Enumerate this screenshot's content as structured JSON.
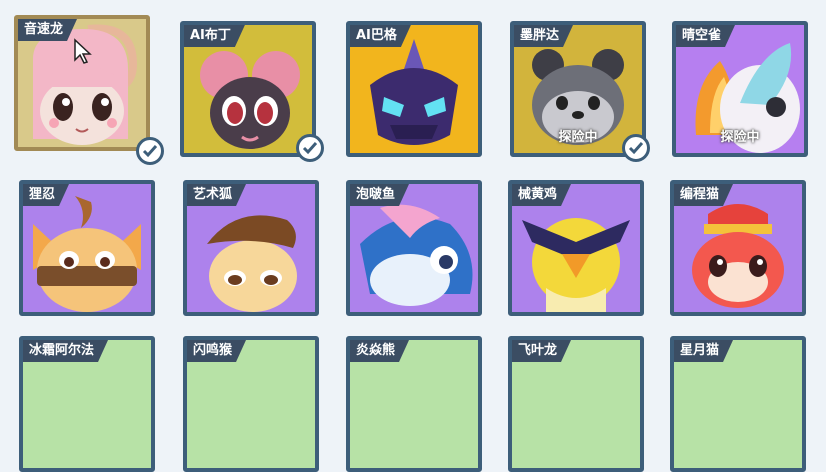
{
  "cards": [
    {
      "name": "音速龙",
      "status": "",
      "checked": true,
      "selected": true
    },
    {
      "name": "AI布丁",
      "status": "",
      "checked": true,
      "selected": false
    },
    {
      "name": "AI巴格",
      "status": "",
      "checked": false,
      "selected": false
    },
    {
      "name": "墨胖达",
      "status": "探险中",
      "checked": true,
      "selected": false
    },
    {
      "name": "晴空雀",
      "status": "探险中",
      "checked": false,
      "selected": false
    },
    {
      "name": "狸忍",
      "status": "",
      "checked": false,
      "selected": false
    },
    {
      "name": "艺术狐",
      "status": "",
      "checked": false,
      "selected": false
    },
    {
      "name": "泡啵鱼",
      "status": "",
      "checked": false,
      "selected": false
    },
    {
      "name": "械黄鸡",
      "status": "",
      "checked": false,
      "selected": false
    },
    {
      "name": "编程猫",
      "status": "",
      "checked": false,
      "selected": false
    },
    {
      "name": "冰霜阿尔法",
      "status": "",
      "checked": false,
      "selected": false
    },
    {
      "name": "闪鸣猴",
      "status": "",
      "checked": false,
      "selected": false
    },
    {
      "name": "炎焱熊",
      "status": "",
      "checked": false,
      "selected": false
    },
    {
      "name": "飞叶龙",
      "status": "",
      "checked": false,
      "selected": false
    },
    {
      "name": "星月猫",
      "status": "",
      "checked": false,
      "selected": false
    }
  ],
  "colors": {
    "frame": "#3d5e7a",
    "selected_frame": "#a28a55",
    "label_bg": "#3b4d63",
    "background": "#eef3f8"
  }
}
